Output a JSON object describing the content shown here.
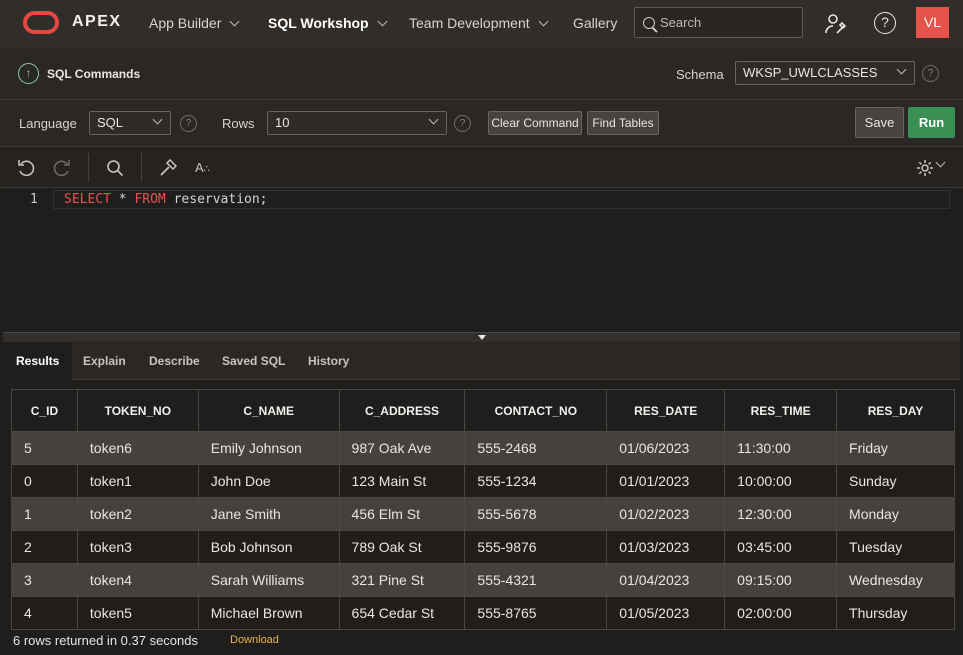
{
  "app": {
    "brand": "APEX",
    "avatar": "VL"
  },
  "nav": {
    "items": [
      {
        "label": "App Builder",
        "has_menu": true
      },
      {
        "label": "SQL Workshop",
        "has_menu": true,
        "active": true
      },
      {
        "label": "Team Development",
        "has_menu": true
      },
      {
        "label": "Gallery",
        "has_menu": false
      }
    ],
    "search_placeholder": "Search",
    "help_glyph": "?"
  },
  "title": {
    "page": "SQL Commands",
    "schema_label": "Schema",
    "schema_value": "WKSP_UWLCLASSES"
  },
  "options": {
    "language_label": "Language",
    "language_value": "SQL",
    "rows_label": "Rows",
    "rows_value": "10",
    "clear_button": "Clear Command",
    "find_tables_button": "Find Tables",
    "save_button": "Save",
    "run_button": "Run"
  },
  "editor": {
    "line_number": "1",
    "tokens": [
      {
        "text": "SELECT",
        "type": "keyword"
      },
      {
        "text": " * ",
        "type": "text"
      },
      {
        "text": "FROM",
        "type": "keyword"
      },
      {
        "text": " reservation;",
        "type": "text"
      }
    ]
  },
  "results_tabs": [
    "Results",
    "Explain",
    "Describe",
    "Saved SQL",
    "History"
  ],
  "table": {
    "columns": [
      "C_ID",
      "TOKEN_NO",
      "C_NAME",
      "C_ADDRESS",
      "CONTACT_NO",
      "RES_DATE",
      "RES_TIME",
      "RES_DAY"
    ],
    "rows": [
      [
        "5",
        "token6",
        "Emily Johnson",
        "987 Oak Ave",
        "555-2468",
        "01/06/2023",
        "11:30:00",
        "Friday"
      ],
      [
        "0",
        "token1",
        "John Doe",
        "123 Main St",
        "555-1234",
        "01/01/2023",
        "10:00:00",
        "Sunday"
      ],
      [
        "1",
        "token2",
        "Jane Smith",
        "456 Elm St",
        "555-5678",
        "01/02/2023",
        "12:30:00",
        "Monday"
      ],
      [
        "2",
        "token3",
        "Bob Johnson",
        "789 Oak St",
        "555-9876",
        "01/03/2023",
        "03:45:00",
        "Tuesday"
      ],
      [
        "3",
        "token4",
        "Sarah Williams",
        "321 Pine St",
        "555-4321",
        "01/04/2023",
        "09:15:00",
        "Wednesday"
      ],
      [
        "4",
        "token5",
        "Michael Brown",
        "654 Cedar St",
        "555-8765",
        "01/05/2023",
        "02:00:00",
        "Thursday"
      ]
    ]
  },
  "footer": {
    "rows_returned": "6 rows returned in 0.37 seconds",
    "download": "Download"
  },
  "colors": {
    "accent_red": "#e5534b",
    "run_green": "#3a8f55",
    "link_gold": "#e8b54a"
  }
}
